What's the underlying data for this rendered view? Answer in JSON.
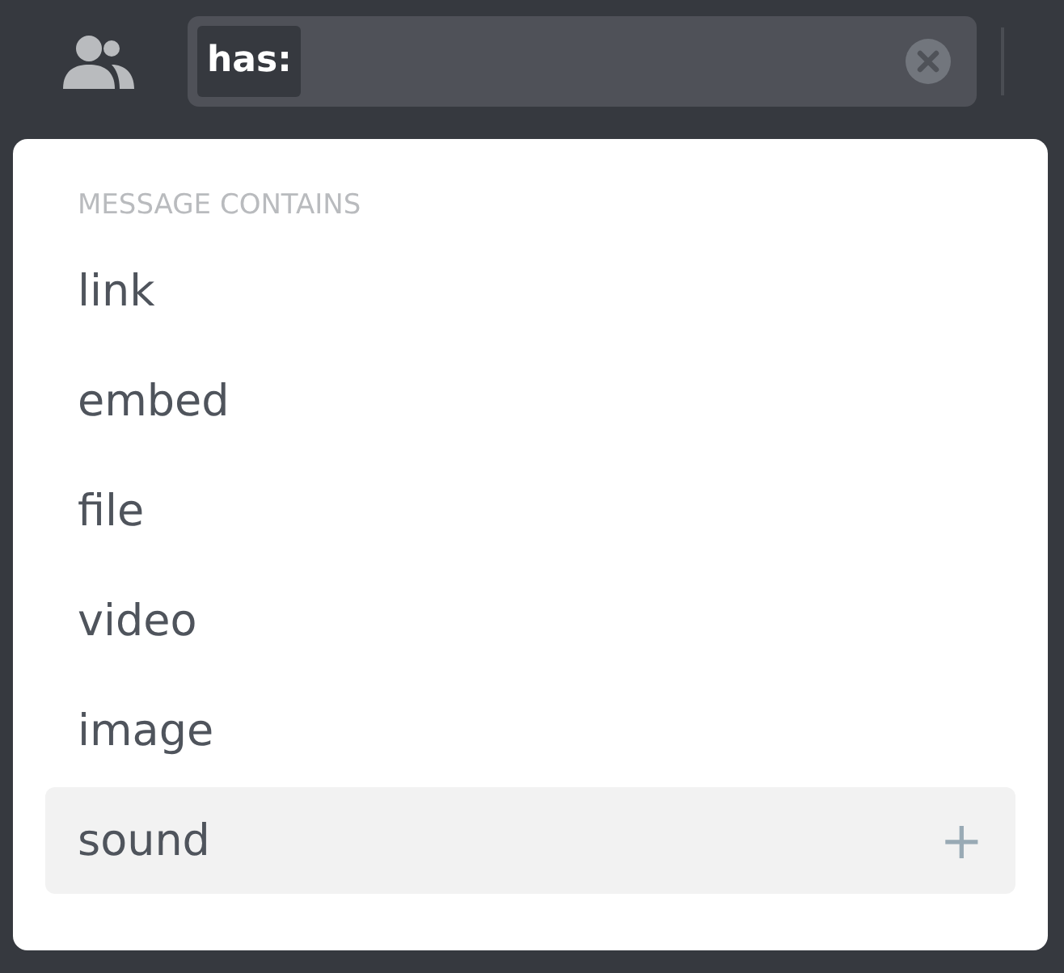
{
  "search": {
    "token": "has:"
  },
  "popup": {
    "header": "MESSAGE CONTAINS",
    "items": [
      {
        "label": "link",
        "selected": false
      },
      {
        "label": "embed",
        "selected": false
      },
      {
        "label": "file",
        "selected": false
      },
      {
        "label": "video",
        "selected": false
      },
      {
        "label": "image",
        "selected": false
      },
      {
        "label": "sound",
        "selected": true,
        "action": "+"
      }
    ]
  }
}
